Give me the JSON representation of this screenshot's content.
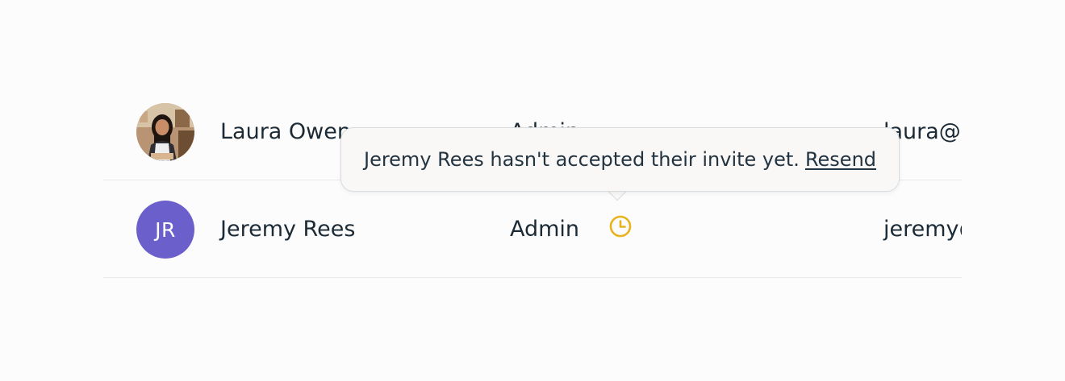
{
  "users": [
    {
      "name": "Laura Owen",
      "role": "Admin",
      "email": "laura@mail.com",
      "avatar": "photo-avatar"
    },
    {
      "name": "Jeremy Rees",
      "role": "Admin",
      "email": "jeremy@mail.com",
      "initials": "JR",
      "status_icon": "clock-icon"
    }
  ],
  "tooltip": {
    "message": "Jeremy Rees hasn't accepted their invite yet.",
    "link_label": "Resend"
  },
  "colors": {
    "avatar_initials_bg": "#6b5fcb",
    "pending_icon": "#e8b21c",
    "text": "#1b2a35",
    "divider": "#e7e9ec"
  }
}
